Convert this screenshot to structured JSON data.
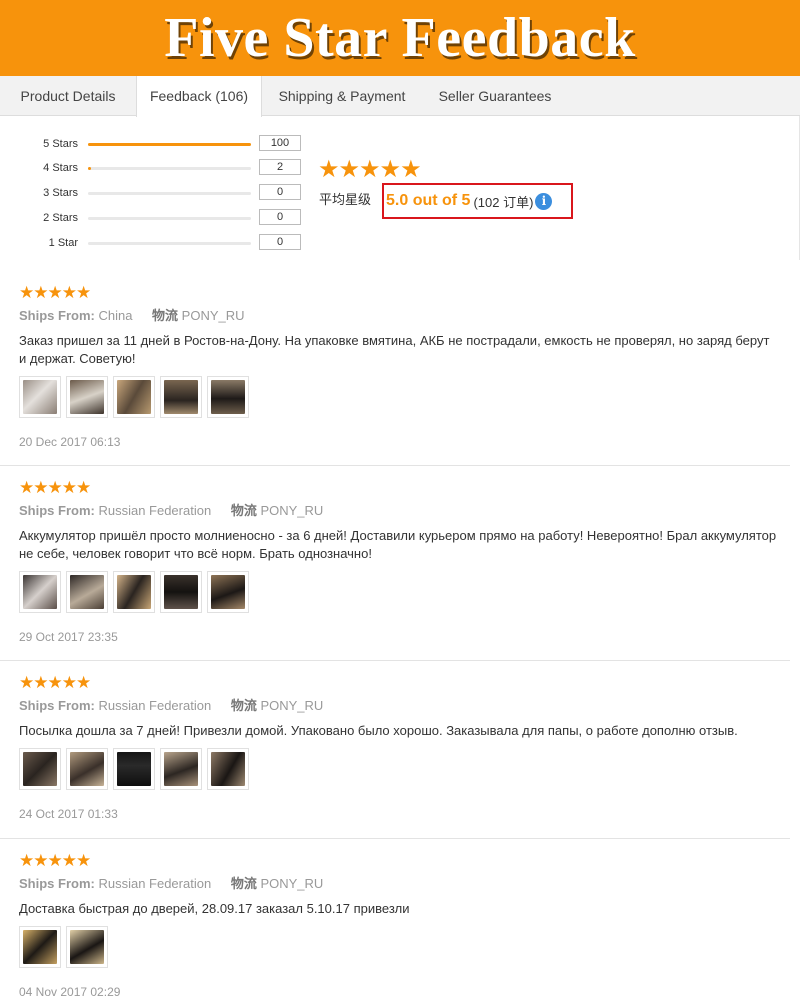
{
  "banner": {
    "title": "Five Star Feedback"
  },
  "tabs": [
    {
      "label": "Product Details"
    },
    {
      "label": "Feedback (106)"
    },
    {
      "label": "Shipping & Payment"
    },
    {
      "label": "Seller Guarantees"
    }
  ],
  "summary": {
    "rows": [
      {
        "label": "5 Stars",
        "count": "100",
        "fraction": 1.0
      },
      {
        "label": "4 Stars",
        "count": "2",
        "fraction": 0.02
      },
      {
        "label": "3 Stars",
        "count": "0",
        "fraction": 0
      },
      {
        "label": "2 Stars",
        "count": "0",
        "fraction": 0
      },
      {
        "label": "1 Star",
        "count": "0",
        "fraction": 0
      }
    ],
    "avg_stars": "★★★★★",
    "avg_label": "平均星级",
    "avg_score": "5.0 out of 5",
    "avg_orders": "(102 订单)",
    "info_icon": "i"
  },
  "colors": {
    "accent": "#f7930c",
    "highlight_border": "#d9161c",
    "info": "#3b8ede"
  },
  "reviews": [
    {
      "stars": "★★★★★",
      "ships_label": "Ships From:",
      "ships_from": " China",
      "logistics_label": "物流",
      "logistics": " PONY_RU",
      "text": "Заказ пришел за 11 дней в Ростов-на-Дону. На упаковке вмятина, АКБ не пострадали, емкость не проверял, но заряд берут и держат. Советую!",
      "date": "20 Dec 2017 06:13"
    },
    {
      "stars": "★★★★★",
      "ships_label": "Ships From:",
      "ships_from": " Russian Federation",
      "logistics_label": "物流",
      "logistics": " PONY_RU",
      "text": "Аккумулятор пришёл просто молниеносно - за 6 дней! Доставили курьером прямо на работу! Невероятно! Брал аккумулятор не себе, человек говорит что всё норм. Брать однозначно!",
      "date": "29 Oct 2017 23:35"
    },
    {
      "stars": "★★★★★",
      "ships_label": "Ships From:",
      "ships_from": " Russian Federation",
      "logistics_label": "物流",
      "logistics": " PONY_RU",
      "text": "Посылка дошла за 7 дней! Привезли домой. Упаковано было хорошо. Заказывала для папы, о работе дополню отзыв.",
      "date": "24 Oct 2017 01:33"
    },
    {
      "stars": "★★★★★",
      "ships_label": "Ships From:",
      "ships_from": " Russian Federation",
      "logistics_label": "物流",
      "logistics": " PONY_RU",
      "text": "Доставка быстрая до дверей, 28.09.17 заказал 5.10.17 привезли",
      "date": "04 Nov 2017 02:29"
    }
  ]
}
